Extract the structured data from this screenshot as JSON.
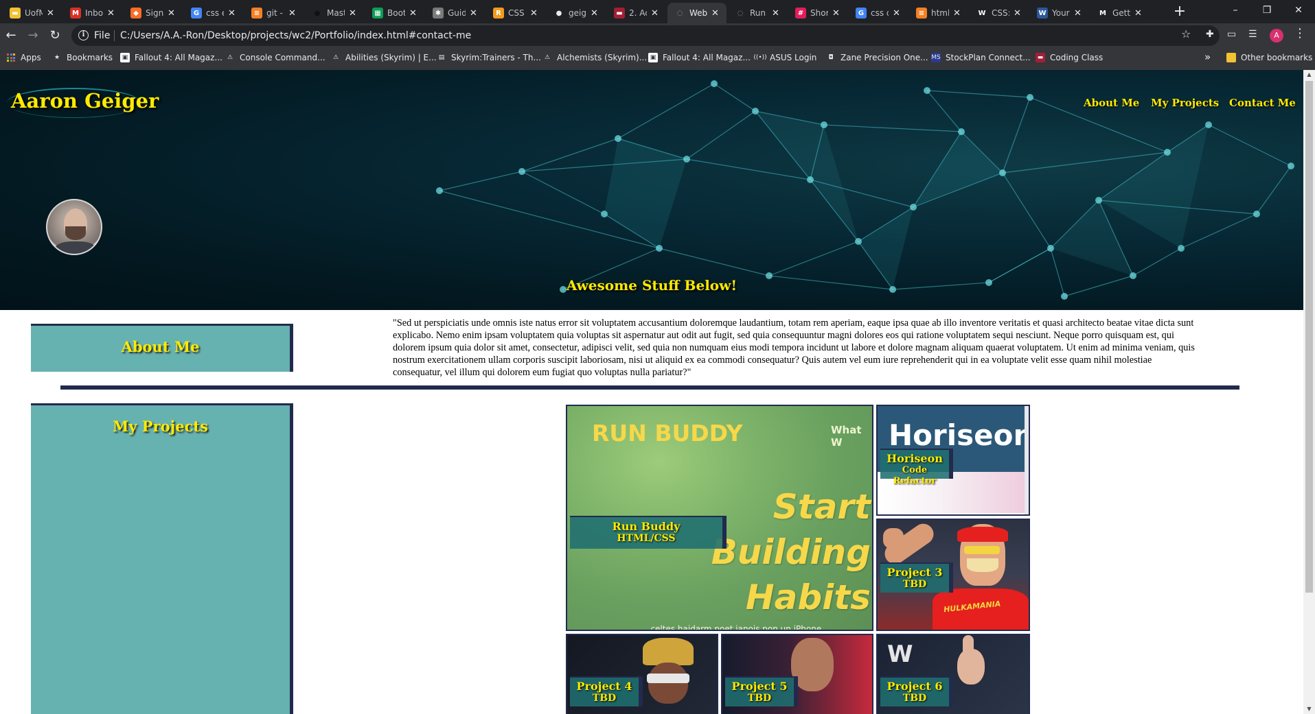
{
  "browser": {
    "tabs": [
      {
        "title": "UofM",
        "favicon": "folder-icon",
        "color": "#f2c232"
      },
      {
        "title": "Inbox",
        "favicon": "gmail-icon",
        "color": "#d93025"
      },
      {
        "title": "Sign",
        "favicon": "gitlab-icon",
        "color": "#fc6d26"
      },
      {
        "title": "css e",
        "favicon": "google-icon",
        "color": "#4285f4"
      },
      {
        "title": "git -",
        "favicon": "stackoverflow-icon",
        "color": "#f48024"
      },
      {
        "title": "Mast",
        "favicon": "github-icon",
        "color": "#111111"
      },
      {
        "title": "Boot",
        "favicon": "sheets-icon",
        "color": "#0f9d58"
      },
      {
        "title": "Guid",
        "favicon": "bug-icon",
        "color": "#7a7a7a"
      },
      {
        "title": "CSS",
        "favicon": "r-icon",
        "color": "#f29b1d"
      },
      {
        "title": "geig",
        "favicon": "github-icon",
        "color": "#e8eaed"
      },
      {
        "title": "2. Ac",
        "favicon": "edx-icon",
        "color": "#a31f34"
      },
      {
        "title": "Web",
        "favicon": "globe-icon",
        "color": "#9aa0a6"
      },
      {
        "title": "Run",
        "favicon": "globe-icon",
        "color": "#9aa0a6"
      },
      {
        "title": "Shor",
        "favicon": "slack-icon",
        "color": "#e01e5a"
      },
      {
        "title": "css d",
        "favicon": "google-icon",
        "color": "#4285f4"
      },
      {
        "title": "html",
        "favicon": "stackoverflow-icon",
        "color": "#f48024"
      },
      {
        "title": "CSS:",
        "favicon": "w3-icon",
        "color": "#ffffff"
      },
      {
        "title": "Your",
        "favicon": "word-icon",
        "color": "#2b579a"
      },
      {
        "title": "Gett",
        "favicon": "medium-icon",
        "color": "#ffffff"
      }
    ],
    "active_tab": 11,
    "new_tab": "+",
    "window_controls": {
      "minimize": "–",
      "restore": "❐",
      "close": "✕"
    },
    "address": {
      "scheme": "File",
      "url": "C:/Users/A.A.-Ron/Desktop/projects/wc2/Portfolio/index.html#contact-me"
    },
    "bookmarks": [
      {
        "label": "Apps",
        "icon": "apps-grid-icon"
      },
      {
        "label": "Bookmarks",
        "icon": "star-icon"
      },
      {
        "label": "Fallout 4: All Magaz...",
        "icon": "fallout-wiki-icon"
      },
      {
        "label": "Console Command...",
        "icon": "skyrim-icon"
      },
      {
        "label": "Abilities (Skyrim) | E...",
        "icon": "skyrim-icon"
      },
      {
        "label": "Skyrim:Trainers - Th...",
        "icon": "uesp-icon"
      },
      {
        "label": "Alchemists (Skyrim)...",
        "icon": "skyrim-icon"
      },
      {
        "label": "Fallout 4: All Magaz...",
        "icon": "fallout-wiki-icon"
      },
      {
        "label": "ASUS Login",
        "icon": "router-icon"
      },
      {
        "label": "Zane Precision One...",
        "icon": "zane-icon"
      },
      {
        "label": "StockPlan Connect...",
        "icon": "ms-icon"
      },
      {
        "label": "Coding Class",
        "icon": "edx-icon"
      }
    ],
    "bookmarks_overflow": "»",
    "other_bookmarks": "Other bookmarks",
    "profile_initial": "A"
  },
  "page": {
    "site_title": "Aaron Geiger",
    "nav": [
      "About Me",
      "My Projects",
      "Contact Me"
    ],
    "tagline": "Awesome Stuff Below!",
    "about": {
      "heading": "About Me",
      "text": "\"Sed ut perspiciatis unde omnis iste natus error sit voluptatem accusantium doloremque laudantium, totam rem aperiam, eaque ipsa quae ab illo inventore veritatis et quasi architecto beatae vitae dicta sunt explicabo. Nemo enim ipsam voluptatem quia voluptas sit aspernatur aut odit aut fugit, sed quia consequuntur magni dolores eos qui ratione voluptatem sequi nesciunt. Neque porro quisquam est, qui dolorem ipsum quia dolor sit amet, consectetur, adipisci velit, sed quia non numquam eius modi tempora incidunt ut labore et dolore magnam aliquam quaerat voluptatem. Ut enim ad minima veniam, quis nostrum exercitationem ullam corporis suscipit laboriosam, nisi ut aliquid ex ea commodi consequatur? Quis autem vel eum iure reprehenderit qui in ea voluptate velit esse quam nihil molestiae consequatur, vel illum qui dolorem eum fugiat quo voluptas nulla pariatur?\""
    },
    "projects": {
      "heading": "My Projects",
      "run_buddy_art": {
        "brand": "RUN BUDDY",
        "corner": "What W",
        "lines": [
          "Start",
          "Building",
          "Habits"
        ],
        "footer": "...celtes haidarm poet ianois pon un iPhone"
      },
      "horiseon_art": {
        "word": "Horiseon"
      },
      "wrestler_art": {
        "shirt_text": "HULKAMANIA",
        "logo": "W"
      },
      "cards": [
        {
          "title": "Run Buddy",
          "subtitle": "HTML/CSS"
        },
        {
          "title": "Horiseon",
          "subtitle": "Code Refactor"
        },
        {
          "title": "Project 3",
          "subtitle": "TBD"
        },
        {
          "title": "Project 4",
          "subtitle": "TBD"
        },
        {
          "title": "Project 5",
          "subtitle": "TBD"
        },
        {
          "title": "Project 6",
          "subtitle": "TBD"
        }
      ]
    },
    "colors": {
      "accent_text": "#ffea00",
      "panel_bg": "#66b2b0",
      "panel_border": "#222a4e",
      "hero_dark": "#031820",
      "hero_teal": "#1b8a93"
    }
  }
}
